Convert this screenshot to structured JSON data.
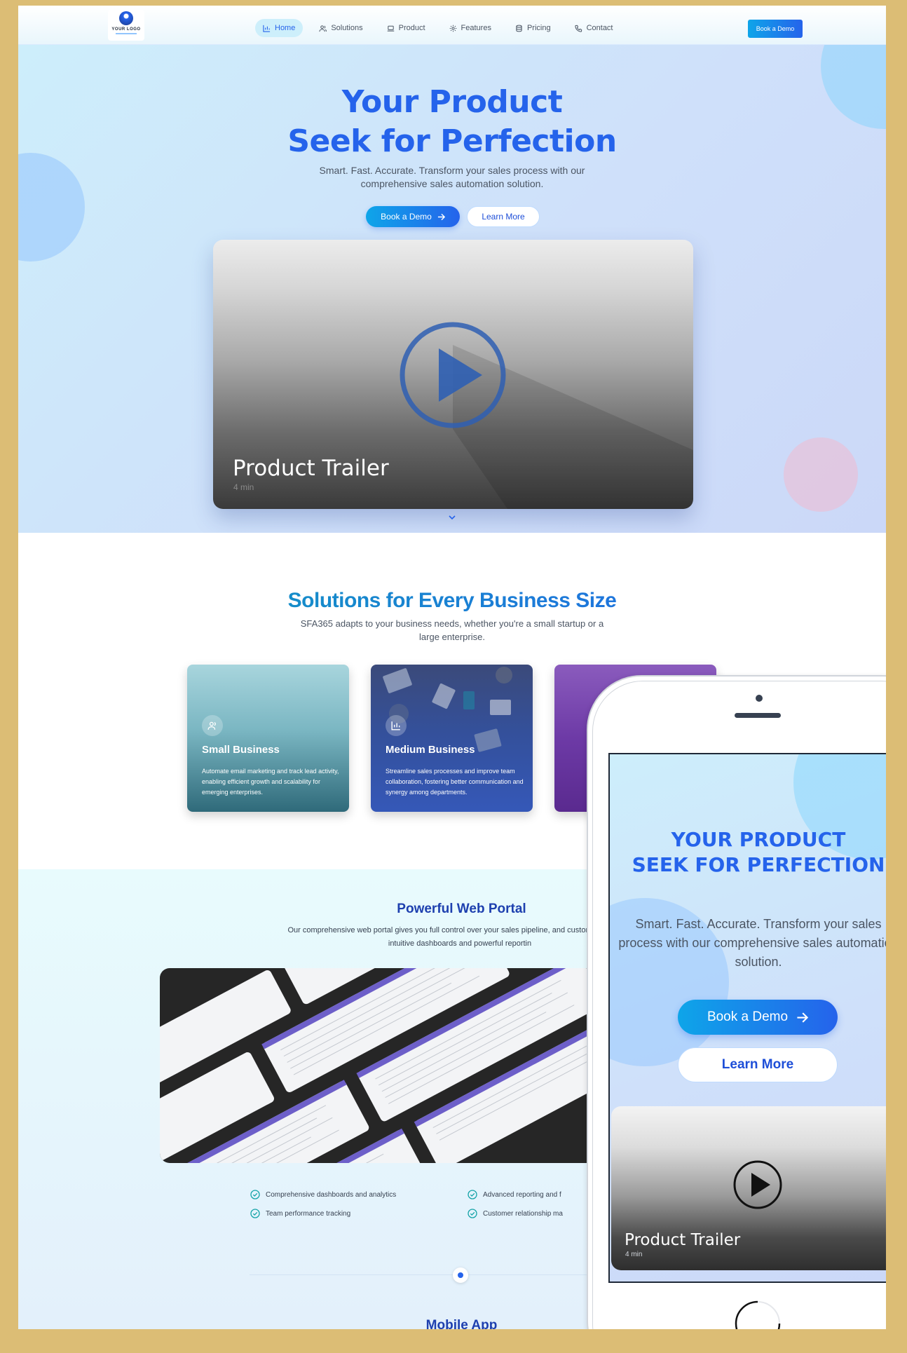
{
  "nav": {
    "logo_text": "YOUR LOGO",
    "items": [
      {
        "label": "Home",
        "icon": "chart-icon",
        "active": true
      },
      {
        "label": "Solutions",
        "icon": "users-icon"
      },
      {
        "label": "Product",
        "icon": "laptop-icon"
      },
      {
        "label": "Features",
        "icon": "gear-icon"
      },
      {
        "label": "Pricing",
        "icon": "database-icon"
      },
      {
        "label": "Contact",
        "icon": "phone-icon"
      }
    ],
    "cta": "Book a Demo"
  },
  "hero": {
    "title_line1": "Your Product",
    "title_line2": "Seek for Perfection",
    "subtitle": "Smart. Fast. Accurate. Transform your sales process with our comprehensive sales automation solution.",
    "primary_button": "Book a Demo",
    "secondary_button": "Learn More",
    "video": {
      "title": "Product Trailer",
      "duration": "4 min"
    }
  },
  "solutions": {
    "title": "Solutions for Every Business Size",
    "subtitle": "SFA365 adapts to your business needs, whether you're a small startup or a large enterprise.",
    "cards": [
      {
        "title": "Small Business",
        "description": "Automate email marketing and track lead activity, enabling efficient growth and scalability for emerging enterprises.",
        "icon": "users-icon"
      },
      {
        "title": "Medium Business",
        "description": "Streamline sales processes and improve team collaboration, fostering better communication and synergy among departments.",
        "icon": "chart-icon"
      }
    ]
  },
  "portal": {
    "title": "Powerful Web Portal",
    "description": "Our comprehensive web portal gives you full control over your sales pipeline, and customer data with intuitive dashboards and powerful reportin",
    "features": [
      "Comprehensive dashboards and analytics",
      "Advanced reporting and f",
      "Team performance tracking",
      "Customer relationship ma"
    ]
  },
  "mobile_section": {
    "title": "Mobile App"
  },
  "phone": {
    "title_line1": "YOUR PRODUCT",
    "title_line2": "SEEK FOR PERFECTION",
    "subtitle": "Smart. Fast. Accurate. Transform your sales process with our comprehensive sales automation solution.",
    "primary_button": "Book a Demo",
    "secondary_button": "Learn More",
    "video": {
      "title": "Product Trailer",
      "duration": "4 min"
    }
  },
  "colors": {
    "accent": "#2563eb",
    "accent2": "#0ea5e9",
    "frame": "#dcbd75"
  }
}
